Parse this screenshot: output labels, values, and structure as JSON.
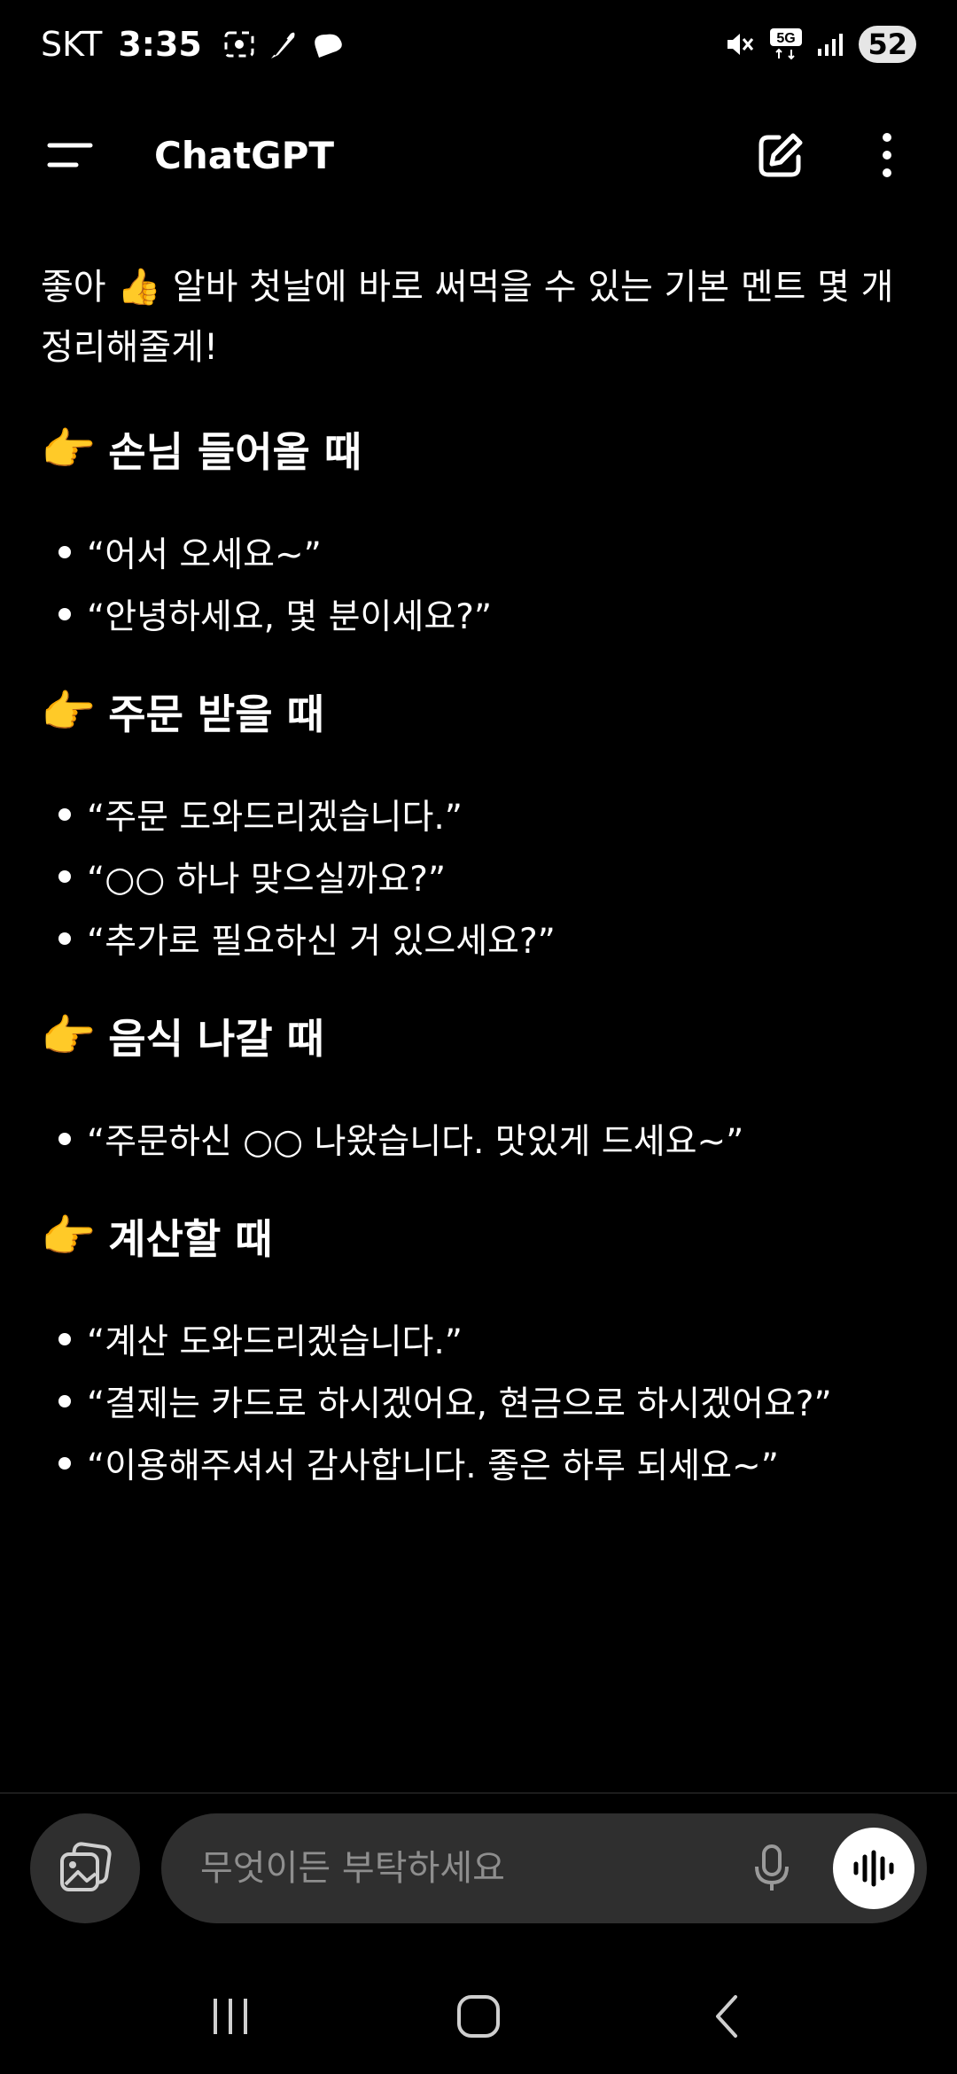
{
  "status_bar": {
    "carrier": "SKT",
    "time": "3:35",
    "network": "5G",
    "battery": "52"
  },
  "app_bar": {
    "title": "ChatGPT"
  },
  "message": {
    "intro": "좋아 👍 알바 첫날에 바로 써먹을 수 있는 기본 멘트 몇 개 정리해줄게!",
    "sections": [
      {
        "emoji": "👉",
        "heading": "손님 들어올 때",
        "items": [
          "“어서 오세요~”",
          "“안녕하세요, 몇 분이세요?”"
        ]
      },
      {
        "emoji": "👉",
        "heading": "주문 받을 때",
        "items": [
          "“주문 도와드리겠습니다.”",
          "“○○ 하나 맞으실까요?”",
          "“추가로 필요하신 거 있으세요?”"
        ]
      },
      {
        "emoji": "👉",
        "heading": "음식 나갈 때",
        "items": [
          "“주문하신 ○○ 나왔습니다. 맛있게 드세요~”"
        ]
      },
      {
        "emoji": "👉",
        "heading": "계산할 때",
        "items": [
          "“계산 도와드리겠습니다.”",
          "“결제는 카드로 하시겠어요, 현금으로 하시겠어요?”",
          "“이용해주셔서 감사합니다. 좋은 하루 되세요~”"
        ]
      }
    ]
  },
  "composer": {
    "placeholder": "무엇이든 부탁하세요"
  },
  "icons": {
    "menu": "menu-icon",
    "new_chat": "edit-icon",
    "more": "more-vertical-icon",
    "attach": "image-attach-icon",
    "mic": "microphone-icon",
    "voice": "voice-waveform-icon",
    "nav_recents": "recents-icon",
    "nav_home": "home-icon",
    "nav_back": "back-icon"
  }
}
